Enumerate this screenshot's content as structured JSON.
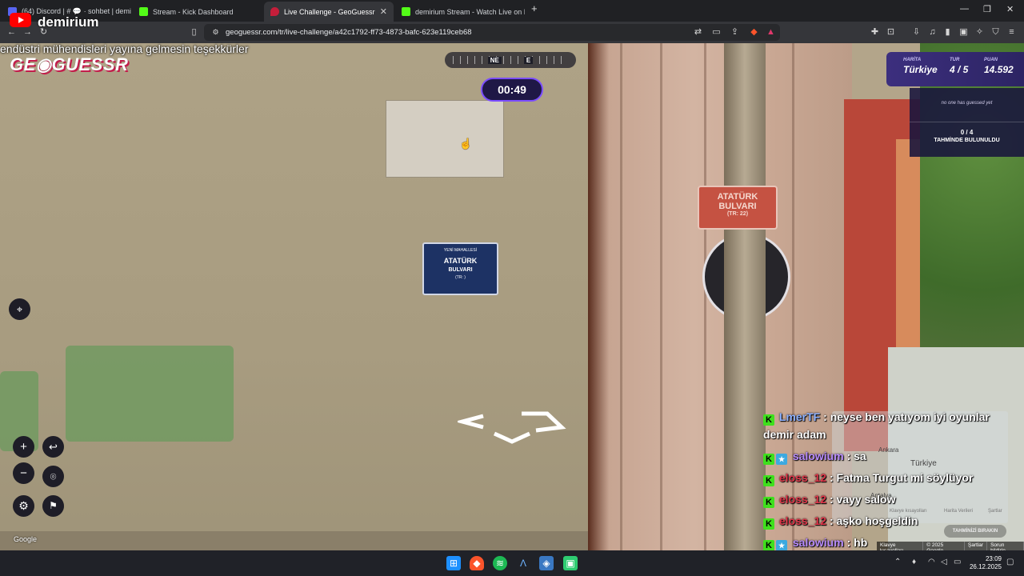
{
  "browser": {
    "tabs": [
      {
        "title": "(64) Discord | # 💬 · sohbet | demiriu",
        "color": "#5865f2"
      },
      {
        "title": "Stream - Kick Dashboard",
        "color": "#53fc18"
      },
      {
        "title": "Live Challenge - GeoGuessr",
        "color": "#c41e3a"
      },
      {
        "title": "demirium Stream - Watch Live on Kic",
        "color": "#53fc18"
      }
    ],
    "active_tab": 2,
    "url": "geoguessr.com/tr/live-challenge/a42c1792-ff73-4873-bafc-623e119ceb68"
  },
  "overlay": {
    "channel_name": "demirium",
    "banner": "endüstri mühendisleri yayına gelmesin teşekkürler",
    "logo_text": "GE◉GUESSR"
  },
  "game": {
    "compass": [
      "NE",
      "E"
    ],
    "timer": "00:49",
    "score": {
      "map_label": "HARİTA",
      "map": "Türkiye",
      "round_label": "TUR",
      "round": "4 / 5",
      "points_label": "PUAN",
      "points": "14.592"
    },
    "no_guess": "no one has guessed yet",
    "guess_count": "0 / 4",
    "guess_label": "TAHMİNDE BULUNULDU"
  },
  "street": {
    "blue_sign_top": "YENİ MAHALLESİ",
    "blue_sign_name": "ATATÜRK",
    "blue_sign_type": "BULVARI",
    "blue_sign_no": "(TR:   )",
    "red_sign_line1": "ATATÜRK",
    "red_sign_line2": "BULVARI",
    "red_sign_line3": "(TR: 22)"
  },
  "minimap": {
    "ankara": "Ankara",
    "country": "Türkiye",
    "antalya": "Antalya",
    "button": "TAHMİNİZİ BIRAKIN",
    "footer": [
      "Klavye kısayolları",
      "© 2025 Google",
      "Şartlar",
      "Sorun bildirin"
    ],
    "faded": [
      "Klavye kısayolları",
      "Harita Verileri",
      "Şartlar"
    ]
  },
  "google_mark": "Google",
  "chat": [
    {
      "user": "LmerTF",
      "color": "#8db1ff",
      "message": "neyse ben yatıyom iyi oyunlar demir adam",
      "badge2": false
    },
    {
      "user": "salowium",
      "color": "#b88cff",
      "message": "sa",
      "badge2": true
    },
    {
      "user": "eloss_12",
      "color": "#e0364a",
      "message": "Fatma Turgut mi söylüyor",
      "badge2": false
    },
    {
      "user": "eloss_12",
      "color": "#e0364a",
      "message": "vayy salow",
      "badge2": false
    },
    {
      "user": "eloss_12",
      "color": "#e0364a",
      "message": "aşko hoşgeldin",
      "badge2": false
    },
    {
      "user": "salowium",
      "color": "#b88cff",
      "message": "hb",
      "badge2": true
    }
  ],
  "taskbar": {
    "time": "23:09",
    "date": "26.12.2025"
  }
}
